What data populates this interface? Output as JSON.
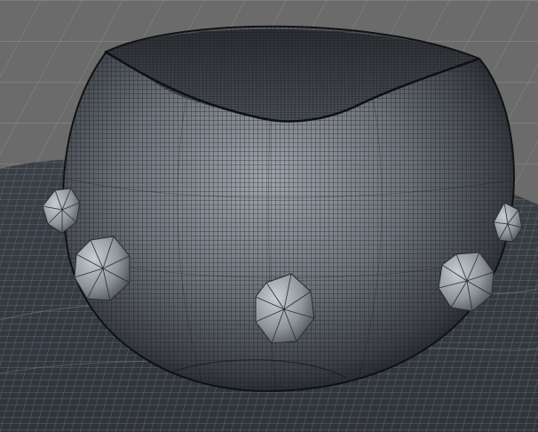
{
  "viewport": {
    "background_color": "#6b6b6b",
    "grid_color": "#8a8a8a",
    "ground_mesh_color": "#40464c",
    "object_color": "#3e4247",
    "wire_color": "#1a1c1f",
    "gem_color": "#9aa0a6"
  }
}
